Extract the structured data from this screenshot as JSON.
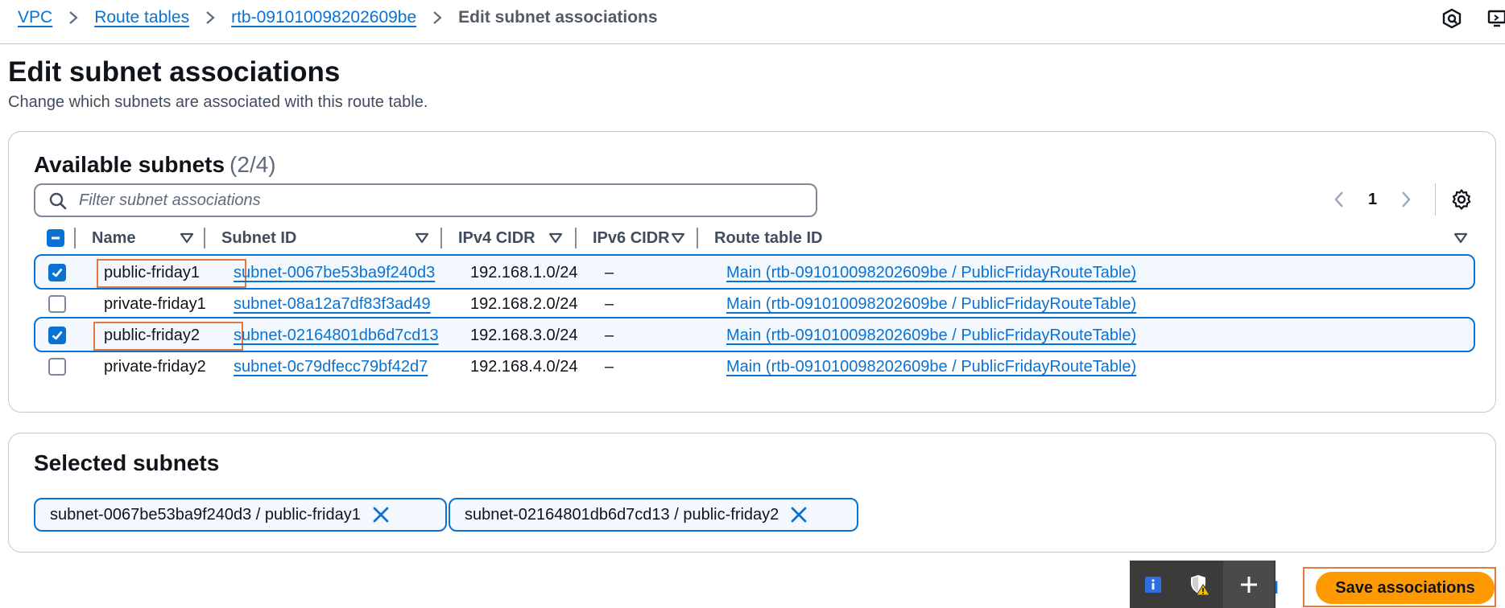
{
  "breadcrumb": {
    "items": [
      "VPC",
      "Route tables",
      "rtb-091010098202609be"
    ],
    "current": "Edit subnet associations"
  },
  "page": {
    "title": "Edit subnet associations",
    "description": "Change which subnets are associated with this route table."
  },
  "available": {
    "title": "Available subnets",
    "count": "(2/4)",
    "filter_placeholder": "Filter subnet associations",
    "page_number": "1",
    "columns": {
      "name": "Name",
      "subnet_id": "Subnet ID",
      "ipv4": "IPv4 CIDR",
      "ipv6": "IPv6 CIDR",
      "route_table": "Route table ID"
    },
    "rows": [
      {
        "name": "public-friday1",
        "subnet_id": "subnet-0067be53ba9f240d3",
        "ipv4": "192.168.1.0/24",
        "ipv6": "–",
        "route_table": "Main (rtb-091010098202609be / PublicFridayRouteTable)",
        "selected": true
      },
      {
        "name": "private-friday1",
        "subnet_id": "subnet-08a12a7df83f3ad49",
        "ipv4": "192.168.2.0/24",
        "ipv6": "–",
        "route_table": "Main (rtb-091010098202609be / PublicFridayRouteTable)",
        "selected": false
      },
      {
        "name": "public-friday2",
        "subnet_id": "subnet-02164801db6d7cd13",
        "ipv4": "192.168.3.0/24",
        "ipv6": "–",
        "route_table": "Main (rtb-091010098202609be / PublicFridayRouteTable)",
        "selected": true
      },
      {
        "name": "private-friday2",
        "subnet_id": "subnet-0c79dfecc79bf42d7",
        "ipv4": "192.168.4.0/24",
        "ipv6": "–",
        "route_table": "Main (rtb-091010098202609be / PublicFridayRouteTable)",
        "selected": false
      }
    ]
  },
  "selected": {
    "title": "Selected subnets",
    "tokens": [
      "subnet-0067be53ba9f240d3 / public-friday1",
      "subnet-02164801db6d7cd13 / public-friday2"
    ]
  },
  "footer": {
    "cancel_fragment": "l",
    "save_label": "Save associations"
  },
  "colors": {
    "link": "#0972d3",
    "primary_button": "#ff9900",
    "annotation_highlight": "#e07941",
    "selected_row_bg": "#f2f8fd"
  },
  "icons": [
    "chevron-right-icon",
    "help-panel-icon",
    "screen-share-icon",
    "search-icon",
    "chevron-left-icon",
    "gear-icon",
    "sort-caret-icon",
    "checkmark-icon",
    "close-icon",
    "info-icon",
    "shield-warning-icon",
    "plus-icon"
  ]
}
